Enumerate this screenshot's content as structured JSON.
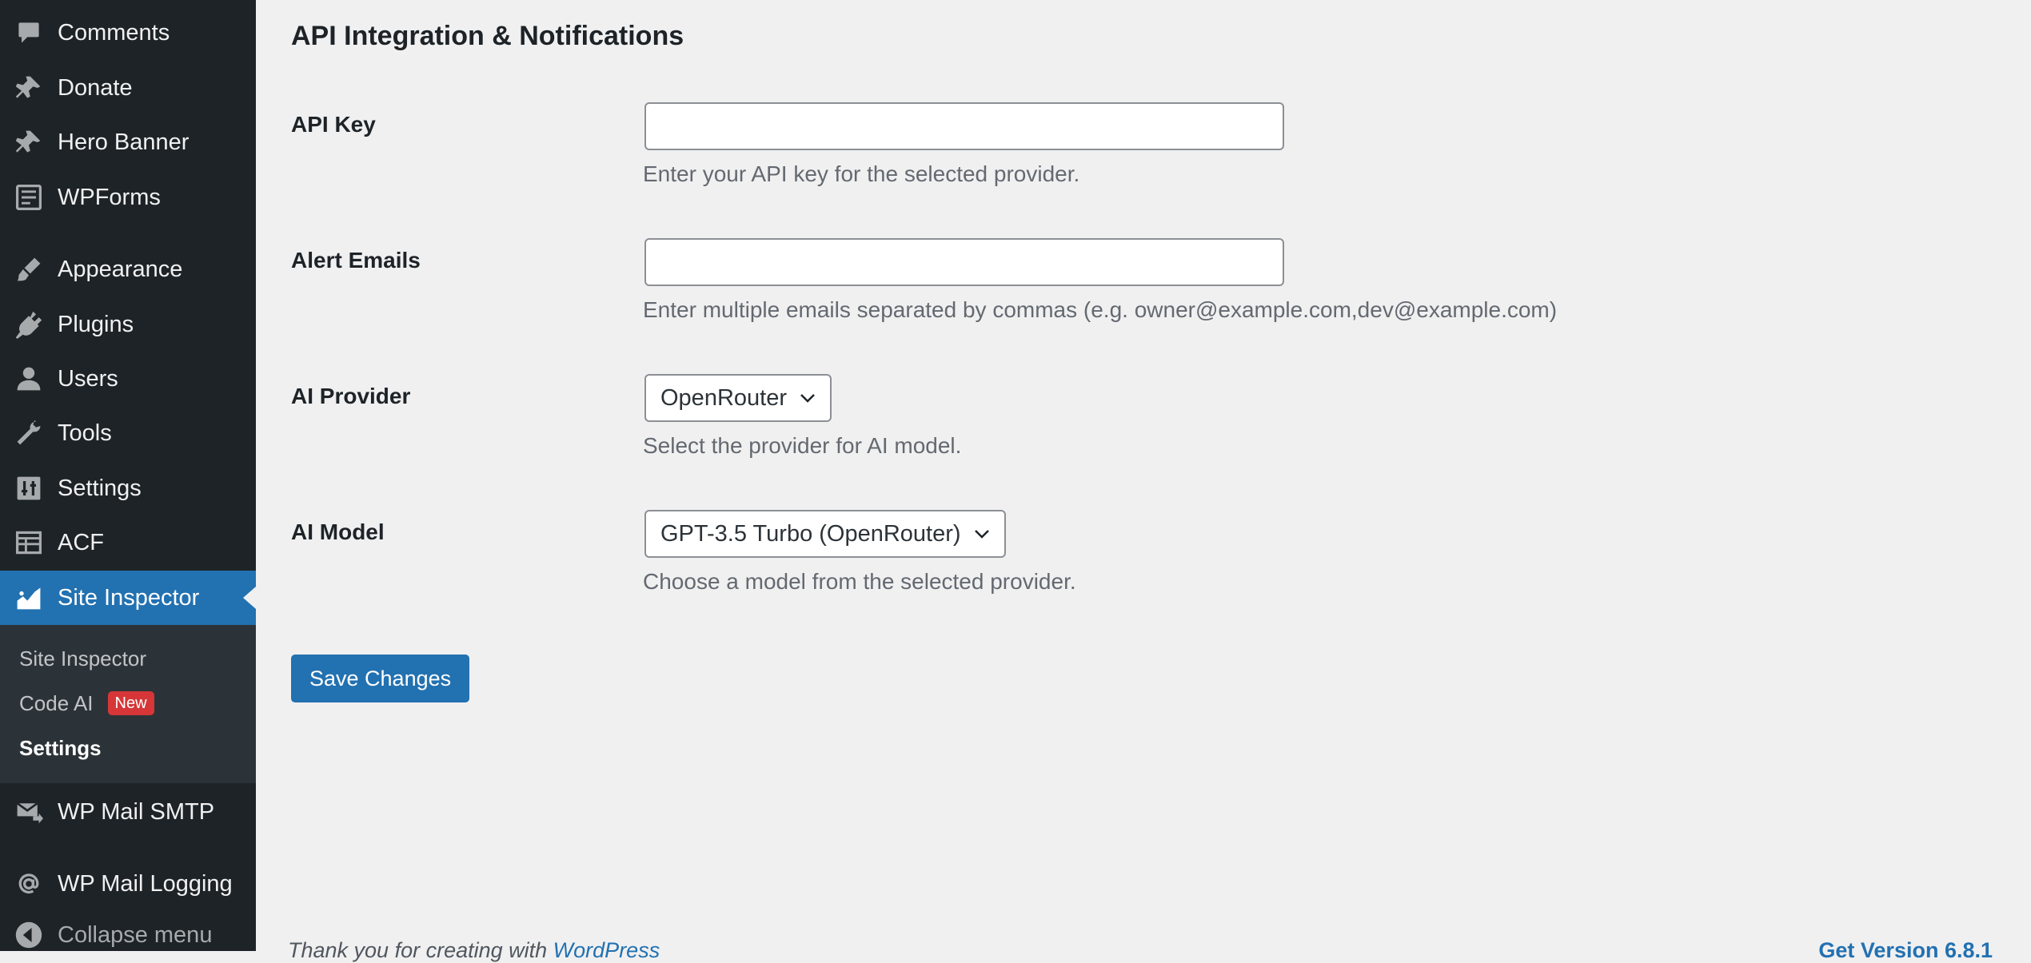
{
  "sidebar": {
    "items": [
      {
        "label": "Comments",
        "icon": "comments-icon"
      },
      {
        "label": "Donate",
        "icon": "pin-icon"
      },
      {
        "label": "Hero Banner",
        "icon": "pin-icon"
      },
      {
        "label": "WPForms",
        "icon": "form-icon"
      },
      {
        "label": "Appearance",
        "icon": "brush-icon"
      },
      {
        "label": "Plugins",
        "icon": "plug-icon"
      },
      {
        "label": "Users",
        "icon": "user-icon"
      },
      {
        "label": "Tools",
        "icon": "wrench-icon"
      },
      {
        "label": "Settings",
        "icon": "sliders-icon"
      },
      {
        "label": "ACF",
        "icon": "table-icon"
      },
      {
        "label": "Site Inspector",
        "icon": "chart-icon"
      },
      {
        "label": "WP Mail SMTP",
        "icon": "mail-icon"
      },
      {
        "label": "WP Mail Logging",
        "icon": "at-icon"
      }
    ],
    "submenu": {
      "site_inspector": "Site Inspector",
      "code_ai": "Code AI",
      "code_ai_badge": "New",
      "settings": "Settings"
    },
    "collapse_label": "Collapse menu"
  },
  "main": {
    "section_title": "API Integration & Notifications",
    "fields": {
      "api_key": {
        "label": "API Key",
        "value": "",
        "description": "Enter your API key for the selected provider."
      },
      "alert_emails": {
        "label": "Alert Emails",
        "value": "",
        "description": "Enter multiple emails separated by commas (e.g. owner@example.com,dev@example.com)"
      },
      "ai_provider": {
        "label": "AI Provider",
        "selected": "OpenRouter",
        "description": "Select the provider for AI model."
      },
      "ai_model": {
        "label": "AI Model",
        "selected": "GPT-3.5 Turbo (OpenRouter)",
        "description": "Choose a model from the selected provider."
      }
    },
    "save_label": "Save Changes"
  },
  "footer": {
    "thanks_prefix": "Thank you for creating with ",
    "thanks_link": "WordPress",
    "version": "Get Version 6.8.1"
  },
  "colors": {
    "sidebar_bg": "#1d2327",
    "submenu_bg": "#2c3338",
    "accent": "#2271b1",
    "badge": "#d63638",
    "page_bg": "#f0f0f1"
  }
}
